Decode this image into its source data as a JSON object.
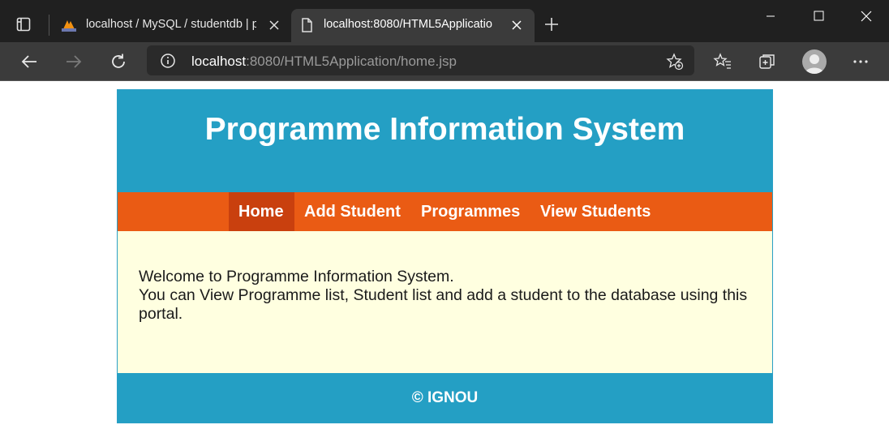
{
  "browser": {
    "tabs": [
      {
        "title": "localhost / MySQL / studentdb | p",
        "active": false
      },
      {
        "title": "localhost:8080/HTML5Applicatio",
        "active": true
      }
    ],
    "address": {
      "host": "localhost",
      "path": ":8080/HTML5Application/home.jsp"
    }
  },
  "site": {
    "title": "Programme Information System",
    "nav": [
      {
        "label": "Home",
        "active": true
      },
      {
        "label": "Add Student",
        "active": false
      },
      {
        "label": "Programmes",
        "active": false
      },
      {
        "label": "View Students",
        "active": false
      }
    ],
    "content": {
      "welcome": "Welcome to Programme Information System.",
      "description": "You can View Programme list, Student list and add a student to the database using this portal."
    },
    "footer": "© IGNOU"
  },
  "colors": {
    "header_bg": "#249fc4",
    "nav_bg": "#ea5b14",
    "nav_active_bg": "#c9400e",
    "content_bg": "#ffffe0"
  }
}
